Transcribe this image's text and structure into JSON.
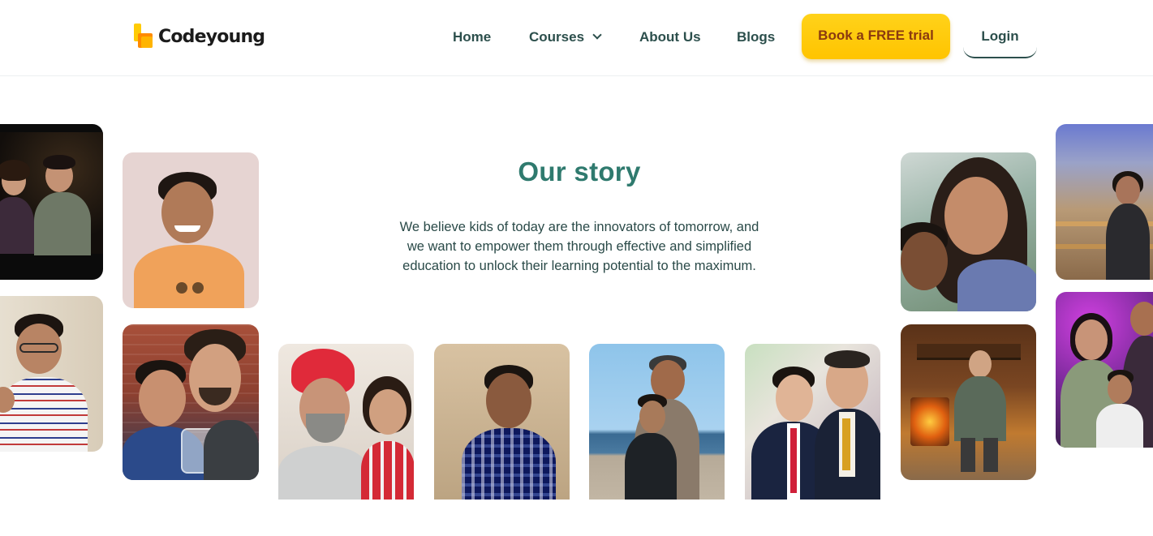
{
  "header": {
    "logo_text": "Codeyoung",
    "nav": {
      "home": "Home",
      "courses": "Courses",
      "about": "About Us",
      "blogs": "Blogs"
    },
    "cta_label": "Book a FREE trial",
    "login_label": "Login"
  },
  "story": {
    "title": "Our story",
    "text": "We believe kids of today are the innovators of tomorrow, and we want to empower them through effective and simplified education to unlock their learning potential to the maximum."
  },
  "photos": [
    "family-photo-night",
    "student-photo-striped-shirt",
    "student-photo-orange-shirt",
    "parent-child-photo-glass",
    "parent-child-photo-turban",
    "student-photo-plaid-shirt",
    "parent-child-photo-beach",
    "parent-child-photo-suit",
    "parent-child-photo-selfie",
    "student-photo-fireplace",
    "parent-photo-balcony",
    "family-photo-purple"
  ],
  "colors": {
    "accent_yellow": "#ffc400",
    "cta_text": "#8a3a10",
    "title_teal": "#2f7a6e",
    "nav_text": "#2c4f4c"
  }
}
